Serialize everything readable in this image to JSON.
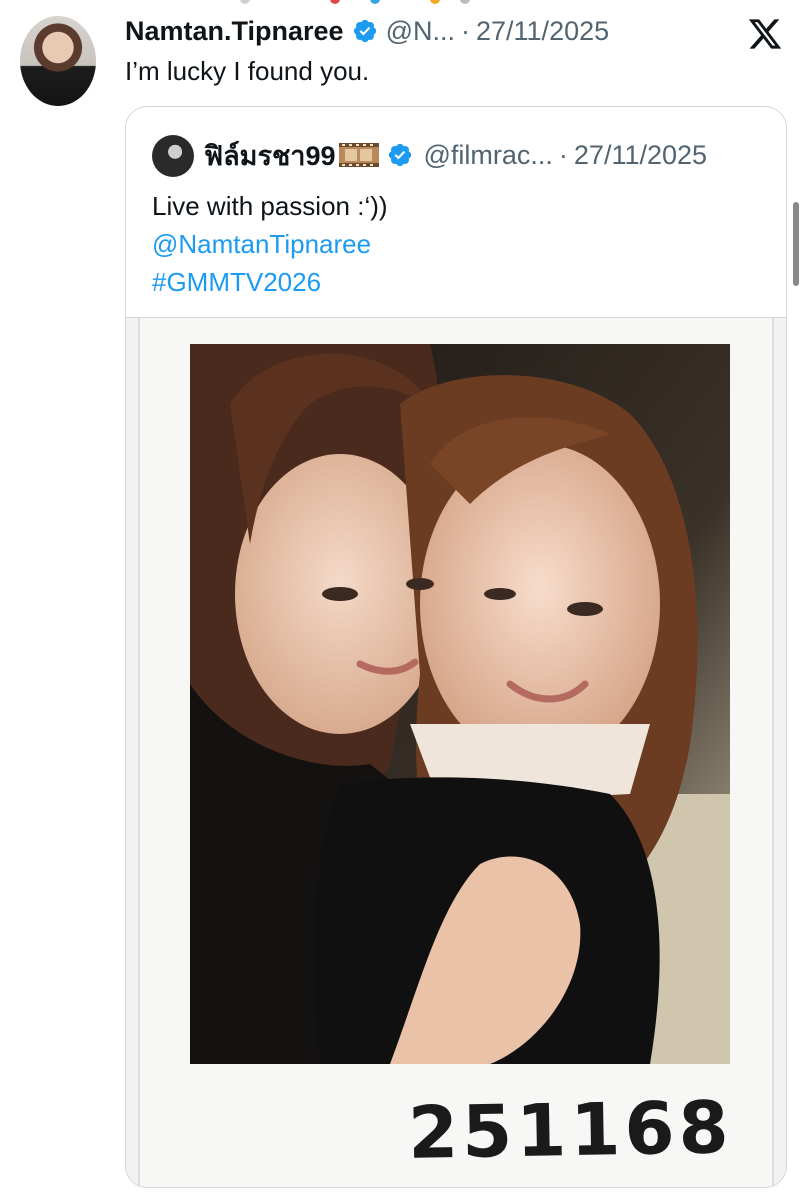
{
  "post": {
    "author_name": "Namtan.Tipnaree",
    "handle": "@N...",
    "separator": "·",
    "date": "27/11/2025",
    "text": "I’m lucky I found you."
  },
  "quote": {
    "author_name": "ฟิล์มรชา99",
    "handle": "@filmrac...",
    "separator": "·",
    "date": "27/11/2025",
    "text": "Live with passion :‘))",
    "mention": "@NamtanTipnaree",
    "hashtag": "#GMMTV2026",
    "photo_caption_number": "251168"
  },
  "icons": {
    "verified": "verified-badge-icon",
    "brand": "x-logo-icon",
    "film": "film-reel-emoji-icon"
  },
  "colors": {
    "link": "#1d9bf0",
    "secondary_text": "#536471",
    "verified": "#1d9bf0",
    "border": "#cfd9de"
  }
}
